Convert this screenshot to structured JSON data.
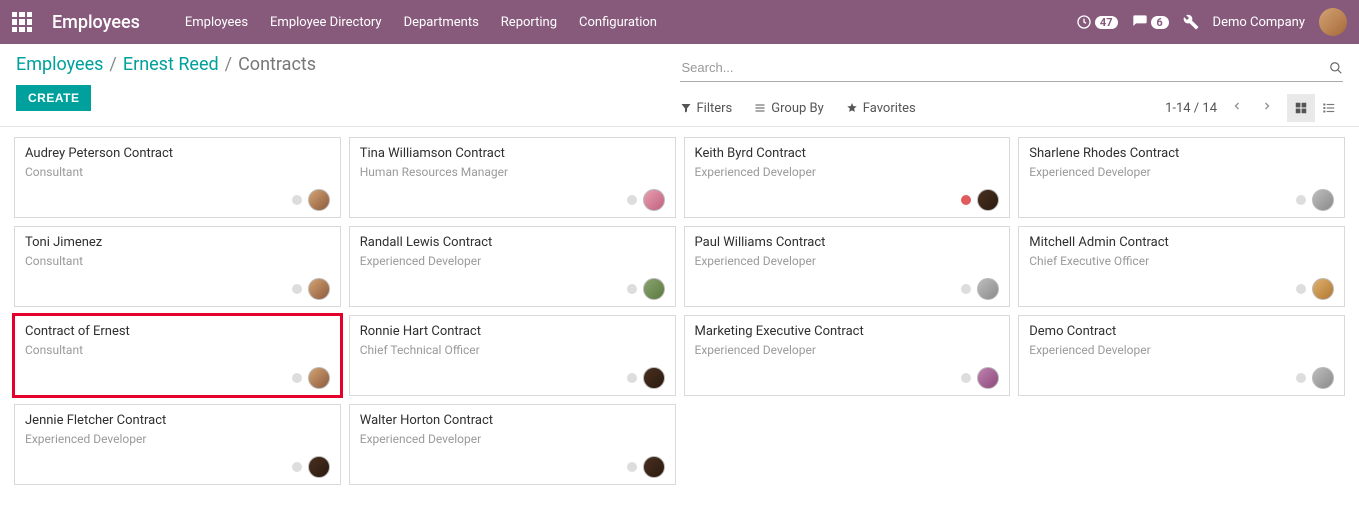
{
  "header": {
    "brand": "Employees",
    "nav": [
      "Employees",
      "Employee Directory",
      "Departments",
      "Reporting",
      "Configuration"
    ],
    "notif1_count": "47",
    "notif2_count": "6",
    "company": "Demo Company"
  },
  "breadcrumb": {
    "root": "Employees",
    "mid": "Ernest Reed",
    "current": "Contracts"
  },
  "create_label": "CREATE",
  "search": {
    "placeholder": "Search..."
  },
  "toolbar": {
    "filters": "Filters",
    "group_by": "Group By",
    "favorites": "Favorites"
  },
  "pager": "1-14 / 14",
  "cards": [
    {
      "title": "Audrey Peterson Contract",
      "subtitle": "Consultant",
      "status": "",
      "avatar": "av-a"
    },
    {
      "title": "Tina Williamson Contract",
      "subtitle": "Human Resources Manager",
      "status": "",
      "avatar": "av-b"
    },
    {
      "title": "Keith Byrd Contract",
      "subtitle": "Experienced Developer",
      "status": "red",
      "avatar": "av-e"
    },
    {
      "title": "Sharlene Rhodes Contract",
      "subtitle": "Experienced Developer",
      "status": "",
      "avatar": "av-f"
    },
    {
      "title": "Toni Jimenez",
      "subtitle": "Consultant",
      "status": "",
      "avatar": "av-a"
    },
    {
      "title": "Randall Lewis Contract",
      "subtitle": "Experienced Developer",
      "status": "",
      "avatar": "av-c"
    },
    {
      "title": "Paul Williams Contract",
      "subtitle": "Experienced Developer",
      "status": "",
      "avatar": "av-f"
    },
    {
      "title": "Mitchell Admin Contract",
      "subtitle": "Chief Executive Officer",
      "status": "",
      "avatar": "av-g"
    },
    {
      "title": "Contract of Ernest",
      "subtitle": "Consultant",
      "status": "",
      "avatar": "av-a",
      "highlighted": true
    },
    {
      "title": "Ronnie Hart Contract",
      "subtitle": "Chief Technical Officer",
      "status": "",
      "avatar": "av-e"
    },
    {
      "title": "Marketing Executive Contract",
      "subtitle": "Experienced Developer",
      "status": "",
      "avatar": "av-h"
    },
    {
      "title": "Demo Contract",
      "subtitle": "Experienced Developer",
      "status": "",
      "avatar": "av-f"
    },
    {
      "title": "Jennie Fletcher Contract",
      "subtitle": "Experienced Developer",
      "status": "",
      "avatar": "av-e"
    },
    {
      "title": "Walter Horton Contract",
      "subtitle": "Experienced Developer",
      "status": "",
      "avatar": "av-e"
    }
  ]
}
